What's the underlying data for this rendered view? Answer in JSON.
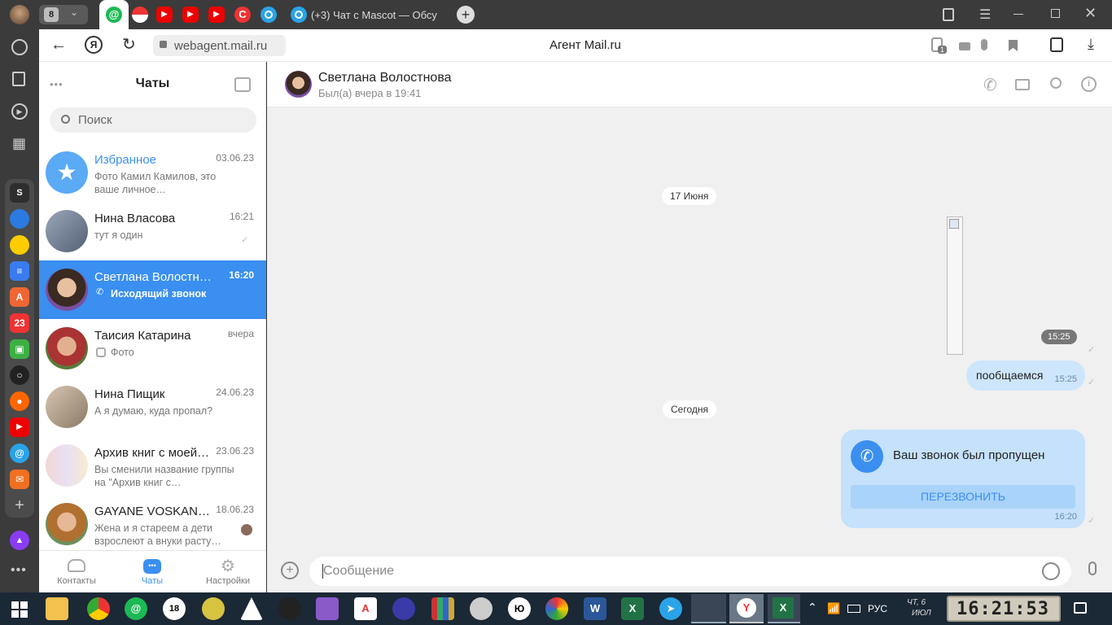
{
  "browser": {
    "tab_count": "8",
    "active_tab_title": "(+3) Чат с Mascot — Обсу",
    "url": "webagent.mail.ru",
    "page_title": "Агент Mail.ru",
    "extension_badge": "1"
  },
  "chats_panel": {
    "title": "Чаты",
    "search_placeholder": "Поиск",
    "items": [
      {
        "name": "Избранное",
        "time": "03.06.23",
        "preview": "Фото Камил Камилов, это ваше личное…"
      },
      {
        "name": "Нина Власова",
        "time": "16:21",
        "preview": "тут я один"
      },
      {
        "name": "Светлана Волостн…",
        "time": "16:20",
        "preview": "Исходящий звонок"
      },
      {
        "name": "Таисия Катарина",
        "time": "вчера",
        "preview": "Фото"
      },
      {
        "name": "Нина Пищик",
        "time": "24.06.23",
        "preview": "А я думаю, куда пропал?"
      },
      {
        "name": "Архив книг с моей…",
        "time": "23.06.23",
        "preview": "Вы сменили название группы на \"Архив книг с…"
      },
      {
        "name": "GAYANE VOSKAN…",
        "time": "18.06.23",
        "preview": "Жена и я стареем а дети взрослеют а внуки расту…"
      }
    ],
    "nav": {
      "contacts": "Контакты",
      "chats": "Чаты",
      "settings": "Настройки"
    }
  },
  "conversation": {
    "contact_name": "Светлана Волостнова",
    "status": "Был(а) вчера в 19:41",
    "date_1": "17 Июня",
    "image_time": "15:25",
    "message_text": "пообщаемся",
    "message_time": "15:25",
    "date_2": "Сегодня",
    "call_text": "Ваш звонок был пропущен",
    "call_button": "ПЕРЕЗВОНИТЬ",
    "call_time": "16:20",
    "message_placeholder": "Сообщение"
  },
  "taskbar": {
    "language": "РУС",
    "day": "чт, 6",
    "month": "июл",
    "clock": "16:21:53"
  },
  "colors": {
    "accent": "#3a8ff0",
    "outgoing_bubble": "#cde6fc",
    "call_bubble": "#c5e1fb"
  }
}
